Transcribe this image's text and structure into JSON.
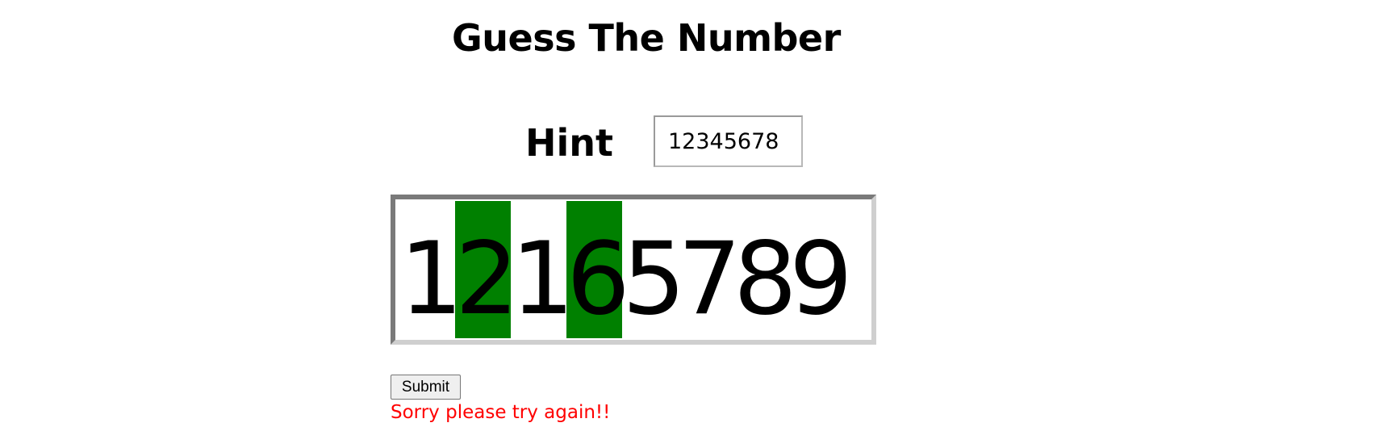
{
  "title": "Guess The Number",
  "hint": {
    "label": "Hint",
    "value": "12345678"
  },
  "guess": {
    "digits": [
      {
        "char": "1",
        "match": false
      },
      {
        "char": "2",
        "match": true
      },
      {
        "char": "1",
        "match": false
      },
      {
        "char": "6",
        "match": true
      },
      {
        "char": "5",
        "match": false
      },
      {
        "char": "7",
        "match": false
      },
      {
        "char": "8",
        "match": false
      },
      {
        "char": "9",
        "match": false
      }
    ],
    "match_color": "#008000"
  },
  "submit_label": "Submit",
  "message": {
    "text": "Sorry please try again!!",
    "color": "#ff0000"
  }
}
